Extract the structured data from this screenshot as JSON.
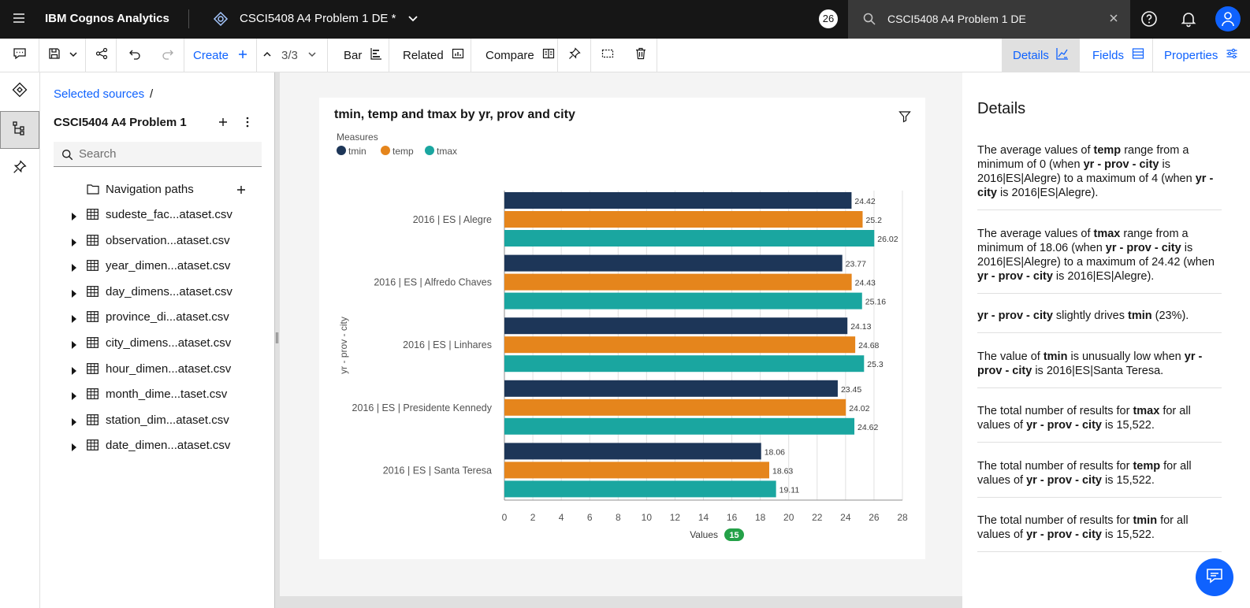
{
  "topbar": {
    "brand": "IBM Cognos Analytics",
    "doc_title": "CSCI5408 A4 Problem 1 DE *",
    "notification_count": "26",
    "search_value": "CSCI5408 A4 Problem 1 DE"
  },
  "toolbar": {
    "create_label": "Create",
    "page_indicator": "3/3",
    "bar_label": "Bar",
    "related_label": "Related",
    "compare_label": "Compare",
    "details_label": "Details",
    "fields_label": "Fields",
    "properties_label": "Properties"
  },
  "sources": {
    "breadcrumb": "Selected sources",
    "breadcrumb_sep": "/",
    "source_name": "CSCI5404 A4 Problem 1",
    "search_placeholder": "Search",
    "nav_paths_label": "Navigation paths",
    "tables": [
      "sudeste_fac...ataset.csv",
      "observation...ataset.csv",
      "year_dimen...ataset.csv",
      "day_dimens...ataset.csv",
      "province_di...ataset.csv",
      "city_dimens...ataset.csv",
      "hour_dimen...ataset.csv",
      "month_dime...taset.csv",
      "station_dim...ataset.csv",
      "date_dimen...ataset.csv"
    ]
  },
  "card": {
    "title": "tmin, temp and tmax by yr, prov and city"
  },
  "chart_data": {
    "type": "bar",
    "orientation": "horizontal",
    "title": "tmin, temp and tmax by yr, prov and city",
    "legend_title": "Measures",
    "legend_position": "top-left",
    "xlabel": "Values",
    "xlabel_badge": "15",
    "ylabel": "yr - prov - city",
    "xlim": [
      0,
      28
    ],
    "xticks": [
      0,
      2,
      4,
      6,
      8,
      10,
      12,
      14,
      16,
      18,
      20,
      22,
      24,
      26,
      28
    ],
    "grid": true,
    "categories": [
      "2016 | ES | Alegre",
      "2016 | ES | Alfredo Chaves",
      "2016 | ES | Linhares",
      "2016 | ES | Presidente Kennedy",
      "2016 | ES | Santa Teresa"
    ],
    "series": [
      {
        "name": "tmin",
        "color": "#1d3658",
        "values": [
          24.42,
          23.77,
          24.13,
          23.45,
          18.06
        ]
      },
      {
        "name": "temp",
        "color": "#e5851c",
        "values": [
          25.2,
          24.43,
          24.68,
          24.02,
          18.63
        ]
      },
      {
        "name": "tmax",
        "color": "#1aa6a0",
        "values": [
          26.02,
          25.16,
          25.3,
          24.62,
          19.11
        ]
      }
    ]
  },
  "details": {
    "title": "Details",
    "insights": [
      "The average values of <b>temp</b> range from a minimum of 0 (when <b>yr - prov - city</b> is 2016|ES|Alegre) to a maximum of 4 (when <b>yr - city</b> is 2016|ES|Alegre).",
      "The average values of <b>tmax</b> range from a minimum of 18.06 (when <b>yr - prov - city</b> is 2016|ES|Alegre) to a maximum of 24.42 (when <b>yr - prov - city</b> is 2016|ES|Alegre).",
      "<b>yr - prov - city</b> slightly drives <b>tmin</b> (23%).",
      "The value of <b>tmin</b> is unusually low when <b>yr - prov - city</b> is 2016|ES|Santa Teresa.",
      "The total number of results for <b>tmax</b> for all values of <b>yr - prov - city</b> is 15,522.",
      "The total number of results for <b>temp</b> for all values of <b>yr - prov - city</b> is 15,522.",
      "The total number of results for <b>tmin</b> for all values of <b>yr - prov - city</b> is 15,522."
    ]
  }
}
